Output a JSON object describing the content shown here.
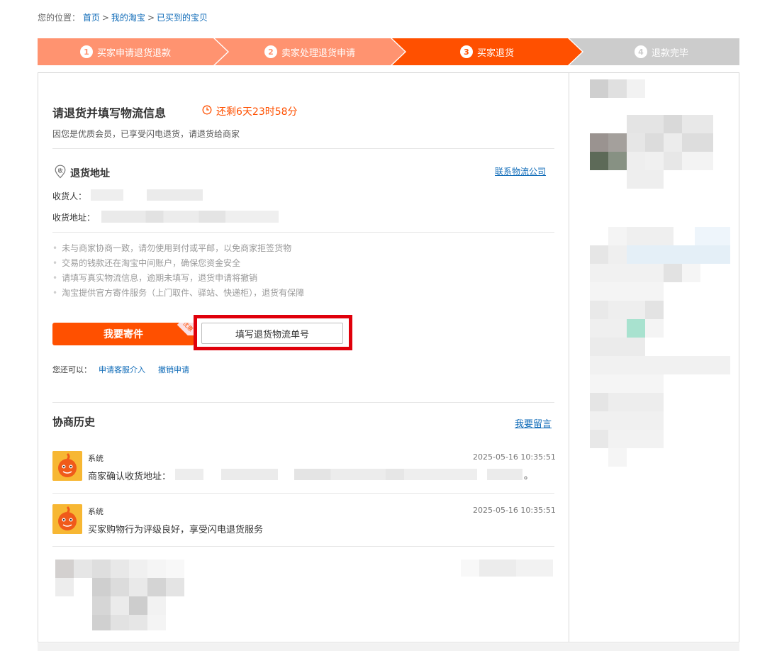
{
  "breadcrumb": {
    "prefix": "您的位置：",
    "items": [
      "首页",
      "我的淘宝",
      "已买到的宝贝"
    ],
    "separator": ">"
  },
  "steps": [
    {
      "num": "1",
      "label": "买家申请退货退款",
      "state": "done",
      "color": "#ff9370"
    },
    {
      "num": "2",
      "label": "卖家处理退货申请",
      "state": "done",
      "color": "#ff9370"
    },
    {
      "num": "3",
      "label": "买家退货",
      "state": "active",
      "color": "#ff5000"
    },
    {
      "num": "4",
      "label": "退款完毕",
      "state": "pending",
      "color": "#cccccc"
    }
  ],
  "main": {
    "title": "请退货并填写物流信息",
    "countdown": "还剩6天23时58分",
    "subtitle": "因您是优质会员，已享受闪电退货，请退货给商家"
  },
  "address": {
    "icon": "location-pin-icon",
    "title": "退货地址",
    "contact_link": "联系物流公司",
    "recipient_label": "收货人：",
    "address_label": "收货地址："
  },
  "tips": [
    "未与商家协商一致，请勿使用到付或平邮，以免商家拒签货物",
    "交易的钱款还在淘宝中间账户，确保您资金安全",
    "请填写真实物流信息，逾期未填写，退货申请将撤销",
    "淘宝提供官方寄件服务（上门取件、驿站、快递柜），退货有保障"
  ],
  "actions": {
    "ship_button": "我要寄件",
    "ship_tag": "优惠",
    "fill_tracking_button": "填写退货物流单号",
    "extra_prefix": "您还可以：",
    "extra_links": [
      "申请客服介入",
      "撤销申请"
    ]
  },
  "history": {
    "title": "协商历史",
    "leave_message": "我要留言",
    "entries": [
      {
        "sender": "系统",
        "time": "2025-05-16 10:35:51",
        "message": "商家确认收货地址："
      },
      {
        "sender": "系统",
        "time": "2025-05-16 10:35:51",
        "message": "买家购物行为评级良好，享受闪电退货服务"
      }
    ]
  },
  "colors": {
    "accent": "#ff5000",
    "link": "#0f6bb8",
    "highlight_frame": "#e0000b"
  }
}
